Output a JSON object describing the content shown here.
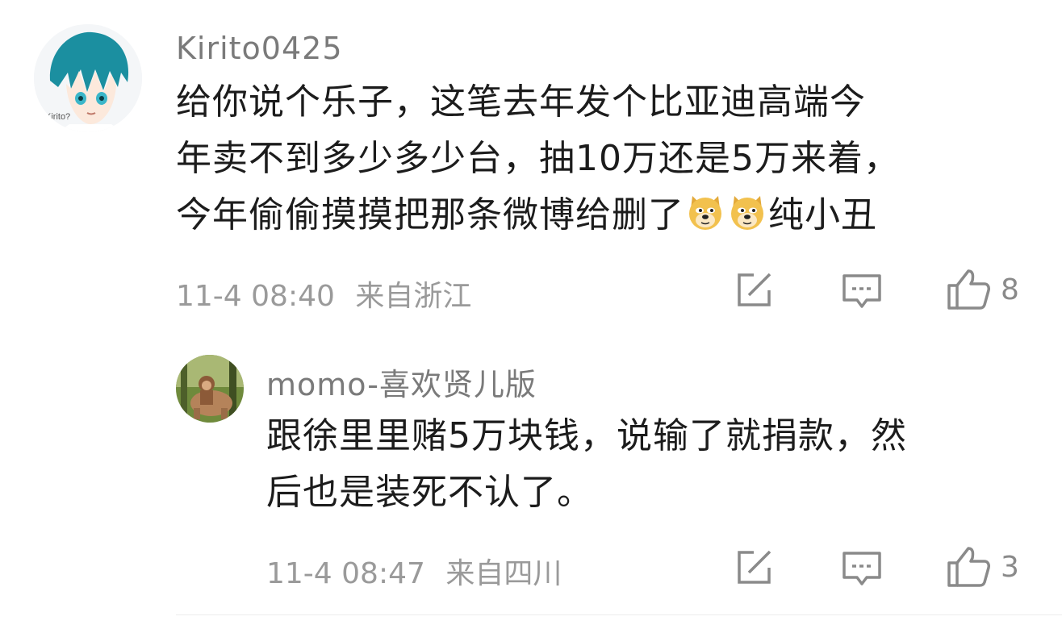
{
  "comments": [
    {
      "username": "Kirito0425",
      "avatar_text": "Kirito?",
      "body_lines": [
        "给你说个乐子，这笔去年发个比亚迪高端今",
        "年卖不到多少多少台，抽10万还是5万来着，",
        "今年偷偷摸摸把那条微博给删了"
      ],
      "body_tail": "纯小丑",
      "emoji": [
        "doge-emoji",
        "doge-emoji"
      ],
      "timestamp": "11-4 08:40",
      "location": "来自浙江",
      "likes": "8"
    },
    {
      "username": "momo-喜欢贤儿版",
      "body_lines": [
        "跟徐里里赌5万块钱，说输了就捐款，然",
        "后也是装死不认了。"
      ],
      "timestamp": "11-4 08:47",
      "location": "来自四川",
      "likes": "3"
    }
  ],
  "icons": {
    "share": "share-icon",
    "comment": "comment-icon",
    "like": "thumbs-up-icon"
  },
  "colors": {
    "username": "#7a7a7a",
    "meta": "#9a9a9a",
    "body": "#1c1c1c",
    "icon": "#8a8a8a",
    "doge": "#f2c14e"
  }
}
